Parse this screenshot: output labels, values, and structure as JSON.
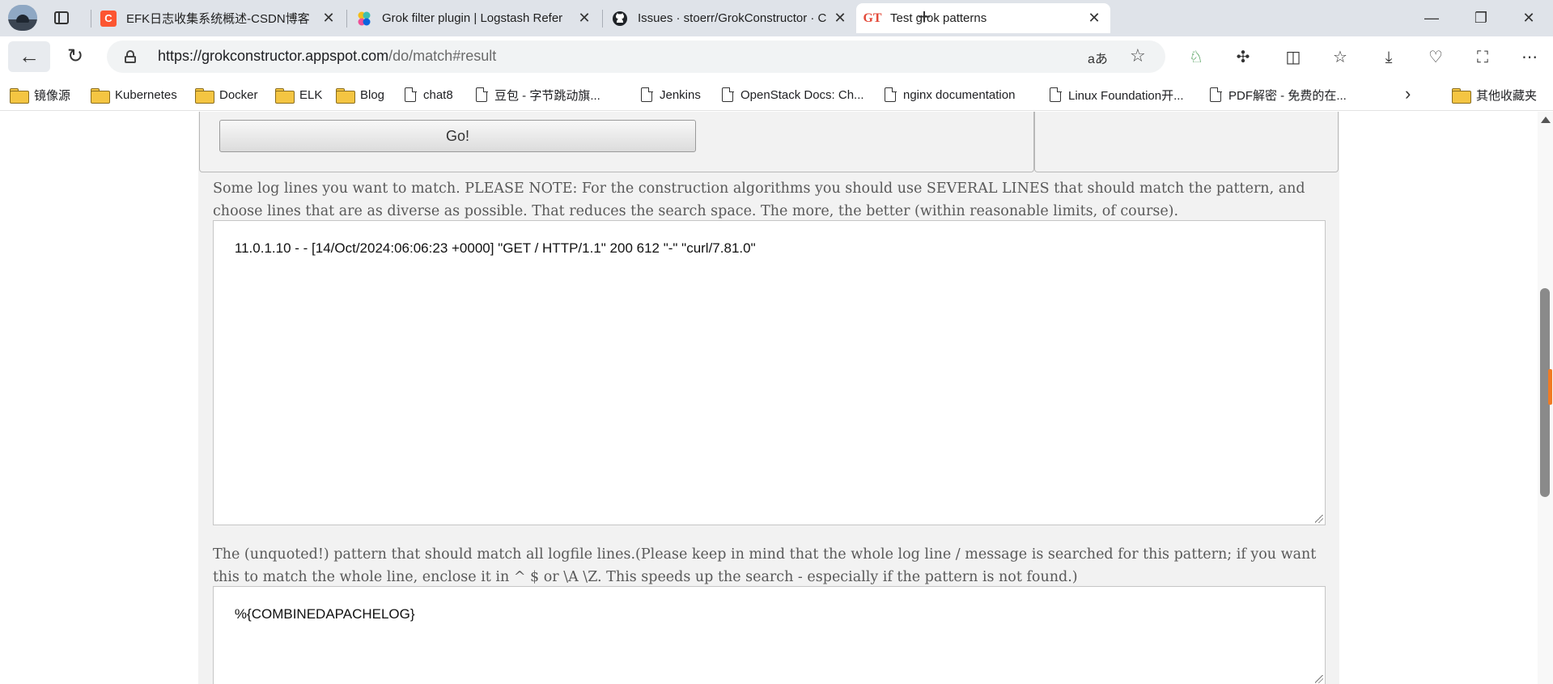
{
  "browser": {
    "tabs": [
      {
        "title": "EFK日志收集系统概述-CSDN博客",
        "favicon": "C",
        "favicon_color": "#fc5531",
        "active": false
      },
      {
        "title": "Grok filter plugin | Logstash Refer",
        "favicon": "elastic-icon",
        "active": false
      },
      {
        "title": "Issues · stoerr/GrokConstructor · C",
        "favicon": "github-icon",
        "active": false
      },
      {
        "title": "Test grok patterns",
        "favicon": "GT",
        "favicon_color": "#e34a3a",
        "active": true
      }
    ],
    "url": {
      "host": "https://grokconstructor.appspot.com",
      "path": "/do/match#result"
    },
    "read_aloud_label": "aあ",
    "bookmarks": [
      {
        "label": "镜像源",
        "type": "folder"
      },
      {
        "label": "Kubernetes",
        "type": "folder"
      },
      {
        "label": "Docker",
        "type": "folder"
      },
      {
        "label": "ELK",
        "type": "folder"
      },
      {
        "label": "Blog",
        "type": "folder"
      },
      {
        "label": "chat8",
        "type": "page"
      },
      {
        "label": "豆包 - 字节跳动旗...",
        "type": "page"
      },
      {
        "label": "Jenkins",
        "type": "page"
      },
      {
        "label": "OpenStack Docs: Ch...",
        "type": "page"
      },
      {
        "label": "nginx documentation",
        "type": "page"
      },
      {
        "label": "Linux Foundation开...",
        "type": "page"
      },
      {
        "label": "PDF解密 - 免费的在...",
        "type": "page"
      },
      {
        "label": "其他收藏夹",
        "type": "folder"
      }
    ]
  },
  "page": {
    "go_label": "Go!",
    "loglines_description": "Some log lines you want to match. PLEASE NOTE: For the construction algorithms you should use SEVERAL LINES that should match the pattern, and choose lines that are as diverse as possible. That reduces the search space. The more, the better (within reasonable limits, of course).",
    "loglines_value": "11.0.1.10 - - [14/Oct/2024:06:06:23 +0000] \"GET / HTTP/1.1\" 200 612 \"-\" \"curl/7.81.0\"",
    "pattern_description": "The (unquoted!) pattern that should match all logfile lines.(Please keep in mind that the whole log line / message is searched for this pattern; if you want this to match the whole line, enclose it in ^ $ or \\A \\Z. This speeds up the search - especially if the pattern is not found.)",
    "pattern_value": "%{COMBINEDAPACHELOG}"
  }
}
